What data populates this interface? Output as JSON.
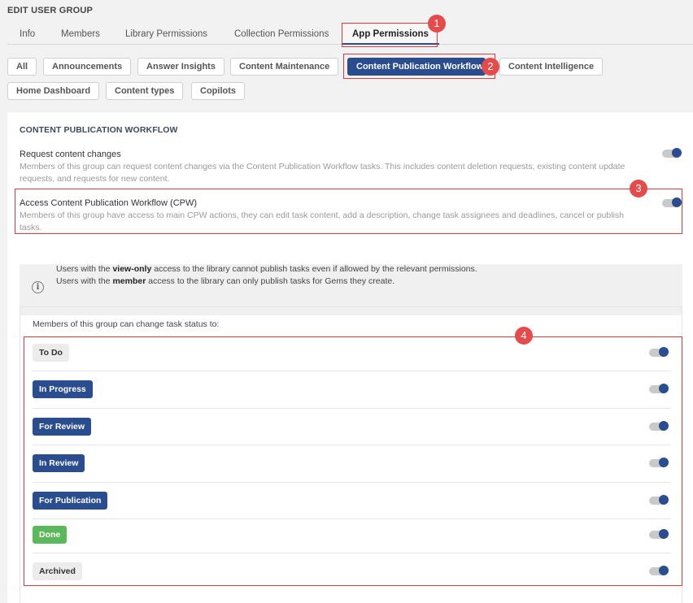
{
  "page": {
    "title": "EDIT USER GROUP"
  },
  "tabs": [
    {
      "label": "Info"
    },
    {
      "label": "Members"
    },
    {
      "label": "Library Permissions"
    },
    {
      "label": "Collection Permissions"
    },
    {
      "label": "App Permissions",
      "active": true
    }
  ],
  "app_chips": [
    {
      "label": "All"
    },
    {
      "label": "Announcements"
    },
    {
      "label": "Answer Insights"
    },
    {
      "label": "Content Maintenance"
    },
    {
      "label": "Content Publication Workflow",
      "active": true
    },
    {
      "label": "Content Intelligence"
    },
    {
      "label": "Home Dashboard"
    },
    {
      "label": "Content types"
    },
    {
      "label": "Copilots"
    }
  ],
  "section": {
    "title": "CONTENT PUBLICATION WORKFLOW",
    "permissions": [
      {
        "title": "Request content changes",
        "description": "Members of this group can request content changes via the Content Publication Workflow tasks. This includes content deletion requests, existing content update requests, and requests for new content.",
        "enabled": true
      },
      {
        "title": "Access Content Publication Workflow (CPW)",
        "description": "Members of this group have access to main CPW actions, they can edit task content, add a description, change task assignees and deadlines, cancel or publish tasks.",
        "enabled": true
      }
    ]
  },
  "info": {
    "line1_prefix": "Users with the ",
    "line1_bold": "view-only",
    "line1_suffix": " access to the library cannot publish tasks even if allowed by the relevant permissions.",
    "line2_prefix": "Users with the ",
    "line2_bold": "member",
    "line2_suffix": " access to the library can only publish tasks for Gems they create."
  },
  "status_section": {
    "label": "Members of this group can change task status to:",
    "statuses": [
      {
        "label": "To Do",
        "bg": "#ececec",
        "fg": "#333333",
        "enabled": true
      },
      {
        "label": "In Progress",
        "bg": "#2a4d8f",
        "fg": "#ffffff",
        "enabled": true
      },
      {
        "label": "For Review",
        "bg": "#2a4d8f",
        "fg": "#ffffff",
        "enabled": true
      },
      {
        "label": "In Review",
        "bg": "#2a4d8f",
        "fg": "#ffffff",
        "enabled": true
      },
      {
        "label": "For Publication",
        "bg": "#2a4d8f",
        "fg": "#ffffff",
        "enabled": true
      },
      {
        "label": "Done",
        "bg": "#5cb85c",
        "fg": "#ffffff",
        "enabled": true
      },
      {
        "label": "Archived",
        "bg": "#ececec",
        "fg": "#333333",
        "enabled": true
      }
    ]
  },
  "annotations": [
    {
      "label": "1"
    },
    {
      "label": "2"
    },
    {
      "label": "3"
    },
    {
      "label": "4"
    }
  ],
  "colors": {
    "accent": "#2a4d8f",
    "annotation": "#e54b4b",
    "success": "#5cb85c"
  }
}
